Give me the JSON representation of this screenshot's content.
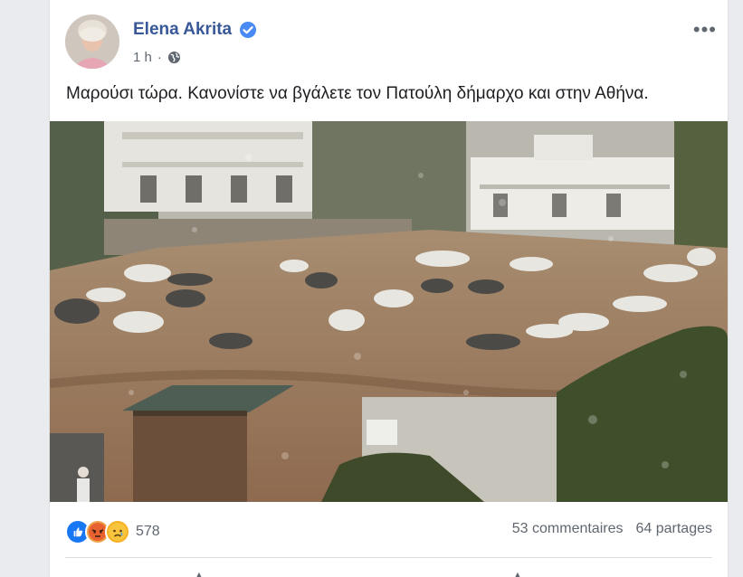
{
  "post": {
    "author": "Elena Akrita",
    "time": "1 h",
    "separator": "·",
    "text": "Μαρούσι τώρα. Κανονίστε να βγάλετε τον Πατούλη δήμαρχο και στην Αθήνα."
  },
  "icons": {
    "verified": "verified-badge-icon",
    "audience": "globe-icon",
    "more": "more-options-icon",
    "reactions": [
      "like-reaction-icon",
      "angry-reaction-icon",
      "sad-reaction-icon"
    ]
  },
  "engagement": {
    "reaction_count": "578",
    "comments": "53 commentaires",
    "shares": "64 partages"
  },
  "colors": {
    "name": "#385898",
    "like": "#1877f2",
    "angry": "#e9710f",
    "sad": "#f7b125"
  }
}
